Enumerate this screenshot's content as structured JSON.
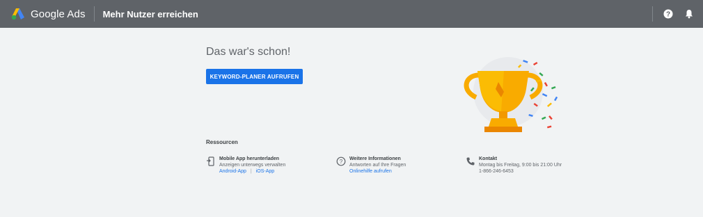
{
  "header": {
    "brand": "Google Ads",
    "page_title": "Mehr Nutzer erreichen"
  },
  "main": {
    "headline": "Das war's schon!",
    "cta_label": "KEYWORD-PLANER AUFRUFEN"
  },
  "resources": {
    "title": "Ressourcen",
    "mobile": {
      "heading": "Mobile App herunterladen",
      "text": "Anzeigen unterwegs verwalten",
      "link_android": "Android-App",
      "separator": "|",
      "link_ios": "iOS-App"
    },
    "info": {
      "heading": "Weitere Informationen",
      "text": "Antworten auf Ihre Fragen",
      "link": "Onlinehilfe aufrufen"
    },
    "contact": {
      "heading": "Kontakt",
      "hours": "Montag bis Freitag, 9:00 bis 21:00 Uhr",
      "phone": "1-866-246-6453"
    }
  },
  "icons": {
    "logo": "google-ads-logo",
    "help": "help-icon",
    "notifications": "bell-icon",
    "phone_app": "mobile-phone-icon",
    "info": "help-circle-icon",
    "contact": "phone-icon",
    "illustration": "trophy-confetti-illustration"
  },
  "colors": {
    "topbar": "#5f6368",
    "background": "#f1f3f4",
    "accent": "#1a73e8",
    "trophy": "#f9ab00"
  }
}
